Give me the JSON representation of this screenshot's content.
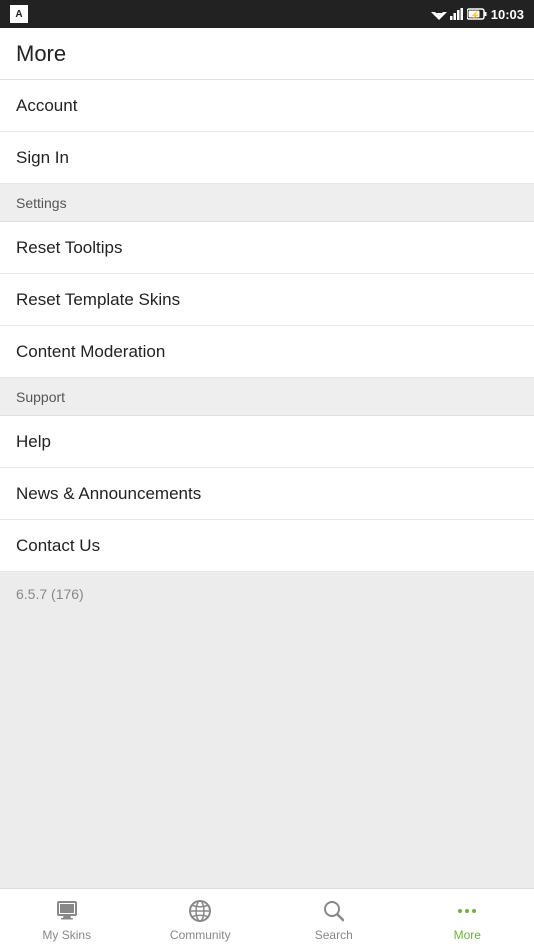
{
  "statusBar": {
    "time": "10:03"
  },
  "header": {
    "title": "More"
  },
  "sections": [
    {
      "type": "item",
      "id": "account",
      "label": "Account"
    },
    {
      "type": "item",
      "id": "sign-in",
      "label": "Sign In"
    },
    {
      "type": "section-header",
      "id": "settings-header",
      "label": "Settings"
    },
    {
      "type": "item",
      "id": "reset-tooltips",
      "label": "Reset Tooltips"
    },
    {
      "type": "item",
      "id": "reset-template-skins",
      "label": "Reset Template Skins"
    },
    {
      "type": "item",
      "id": "content-moderation",
      "label": "Content Moderation"
    },
    {
      "type": "section-header",
      "id": "support-header",
      "label": "Support"
    },
    {
      "type": "item",
      "id": "help",
      "label": "Help"
    },
    {
      "type": "item",
      "id": "news-announcements",
      "label": "News & Announcements"
    },
    {
      "type": "item",
      "id": "contact-us",
      "label": "Contact Us"
    }
  ],
  "version": "6.5.7 (176)",
  "bottomNav": {
    "items": [
      {
        "id": "my-skins",
        "label": "My Skins",
        "active": false
      },
      {
        "id": "community",
        "label": "Community",
        "active": false
      },
      {
        "id": "search",
        "label": "Search",
        "active": false
      },
      {
        "id": "more",
        "label": "More",
        "active": true
      }
    ]
  }
}
